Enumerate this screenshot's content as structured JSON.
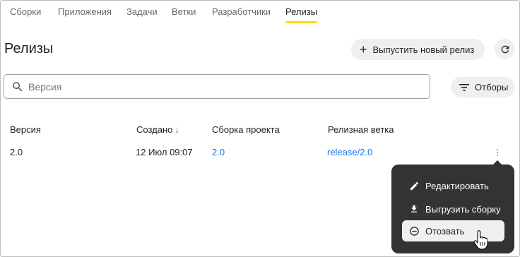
{
  "nav": {
    "tabs": [
      {
        "label": "Сборки"
      },
      {
        "label": "Приложения"
      },
      {
        "label": "Задачи"
      },
      {
        "label": "Ветки"
      },
      {
        "label": "Разработчики"
      },
      {
        "label": "Релизы",
        "active": true
      }
    ]
  },
  "page": {
    "title": "Релизы",
    "release_button_label": "Выпустить новый релиз",
    "search_placeholder": "Версия",
    "filters_label": "Отборы"
  },
  "table": {
    "headers": {
      "version": "Версия",
      "created": "Создано",
      "build": "Сборка проекта",
      "branch": "Релизная ветка"
    },
    "sort_indicator": "↓",
    "rows": [
      {
        "version": "2.0",
        "created": "12 Июл 09:07",
        "build": "2.0",
        "branch": "release/2.0"
      }
    ]
  },
  "context_menu": {
    "items": [
      {
        "label": "Редактировать",
        "icon": "pencil-icon"
      },
      {
        "label": "Выгрузить сборку",
        "icon": "download-icon"
      },
      {
        "label": "Отозвать",
        "icon": "minus-circle-icon",
        "hovered": true
      }
    ]
  },
  "colors": {
    "accent_underline": "#ffdb00",
    "link": "#1a73e8",
    "menu_bg": "#333333"
  }
}
